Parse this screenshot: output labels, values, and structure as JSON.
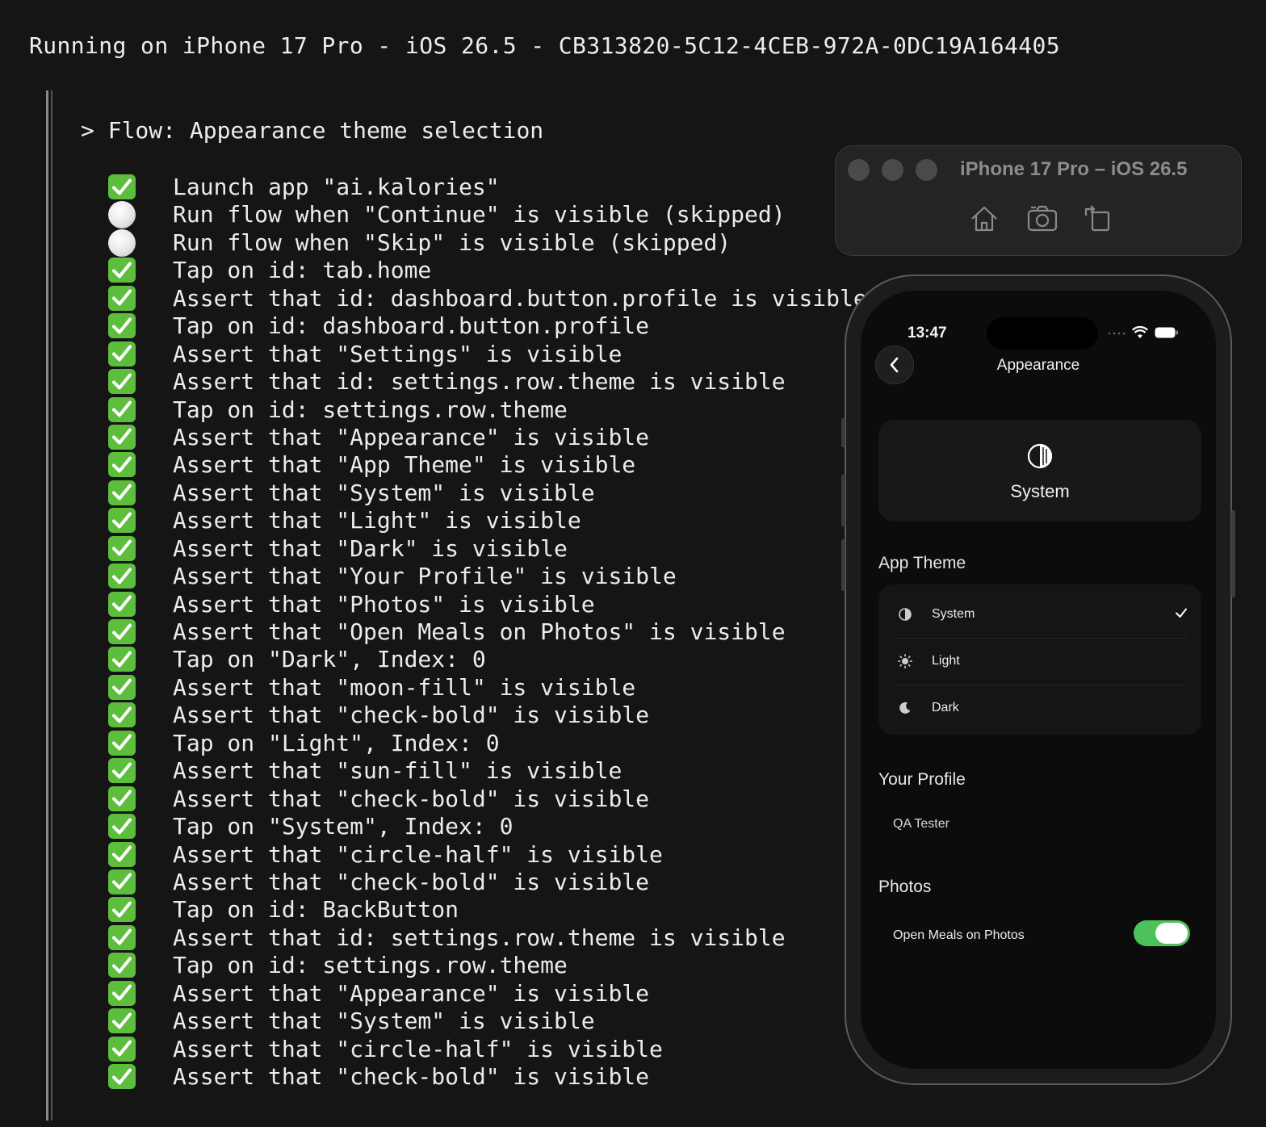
{
  "terminal": {
    "header": "Running on iPhone 17 Pro - iOS 26.5 - CB313820-5C12-4CEB-972A-0DC19A164405",
    "flow_title": "> Flow: Appearance theme selection",
    "steps": [
      {
        "status": "pass",
        "text": "Launch app \"ai.kalories\""
      },
      {
        "status": "skip",
        "text": "Run flow when \"Continue\" is visible (skipped)"
      },
      {
        "status": "skip",
        "text": "Run flow when \"Skip\" is visible (skipped)"
      },
      {
        "status": "pass",
        "text": "Tap on id: tab.home"
      },
      {
        "status": "pass",
        "text": "Assert that id: dashboard.button.profile is visible"
      },
      {
        "status": "pass",
        "text": "Tap on id: dashboard.button.profile"
      },
      {
        "status": "pass",
        "text": "Assert that \"Settings\" is visible"
      },
      {
        "status": "pass",
        "text": "Assert that id: settings.row.theme is visible"
      },
      {
        "status": "pass",
        "text": "Tap on id: settings.row.theme"
      },
      {
        "status": "pass",
        "text": "Assert that \"Appearance\" is visible"
      },
      {
        "status": "pass",
        "text": "Assert that \"App Theme\" is visible"
      },
      {
        "status": "pass",
        "text": "Assert that \"System\" is visible"
      },
      {
        "status": "pass",
        "text": "Assert that \"Light\" is visible"
      },
      {
        "status": "pass",
        "text": "Assert that \"Dark\" is visible"
      },
      {
        "status": "pass",
        "text": "Assert that \"Your Profile\" is visible"
      },
      {
        "status": "pass",
        "text": "Assert that \"Photos\" is visible"
      },
      {
        "status": "pass",
        "text": "Assert that \"Open Meals on Photos\" is visible"
      },
      {
        "status": "pass",
        "text": "Tap on \"Dark\", Index: 0"
      },
      {
        "status": "pass",
        "text": "Assert that \"moon-fill\" is visible"
      },
      {
        "status": "pass",
        "text": "Assert that \"check-bold\" is visible"
      },
      {
        "status": "pass",
        "text": "Tap on \"Light\", Index: 0"
      },
      {
        "status": "pass",
        "text": "Assert that \"sun-fill\" is visible"
      },
      {
        "status": "pass",
        "text": "Assert that \"check-bold\" is visible"
      },
      {
        "status": "pass",
        "text": "Tap on \"System\", Index: 0"
      },
      {
        "status": "pass",
        "text": "Assert that \"circle-half\" is visible"
      },
      {
        "status": "pass",
        "text": "Assert that \"check-bold\" is visible"
      },
      {
        "status": "pass",
        "text": "Tap on id: BackButton"
      },
      {
        "status": "pass",
        "text": "Assert that id: settings.row.theme is visible"
      },
      {
        "status": "pass",
        "text": "Tap on id: settings.row.theme"
      },
      {
        "status": "pass",
        "text": "Assert that \"Appearance\" is visible"
      },
      {
        "status": "pass",
        "text": "Assert that \"System\" is visible"
      },
      {
        "status": "pass",
        "text": "Assert that \"circle-half\" is visible"
      },
      {
        "status": "pass",
        "text": "Assert that \"check-bold\" is visible"
      }
    ],
    "icons": {
      "pass": "check-mark-button-icon",
      "skip": "white-circle-icon"
    }
  },
  "simulator": {
    "title": "iPhone 17 Pro – iOS 26.5",
    "toolbar": [
      "home-icon",
      "screenshot-icon",
      "rotate-icon"
    ]
  },
  "phone": {
    "status_time": "13:47",
    "nav_title": "Appearance",
    "current_theme": {
      "icon": "circle-half-icon",
      "label": "System"
    },
    "app_theme_title": "App Theme",
    "themes": [
      {
        "label": "System",
        "icon": "circle-half-icon",
        "selected": true
      },
      {
        "label": "Light",
        "icon": "sun-fill-icon",
        "selected": false
      },
      {
        "label": "Dark",
        "icon": "moon-fill-icon",
        "selected": false
      }
    ],
    "profile_title": "Your Profile",
    "profile_name": "QA Tester",
    "photos_title": "Photos",
    "photos_option": {
      "label": "Open Meals on Photos",
      "enabled": true
    },
    "accent_color": "#4bc35a"
  }
}
